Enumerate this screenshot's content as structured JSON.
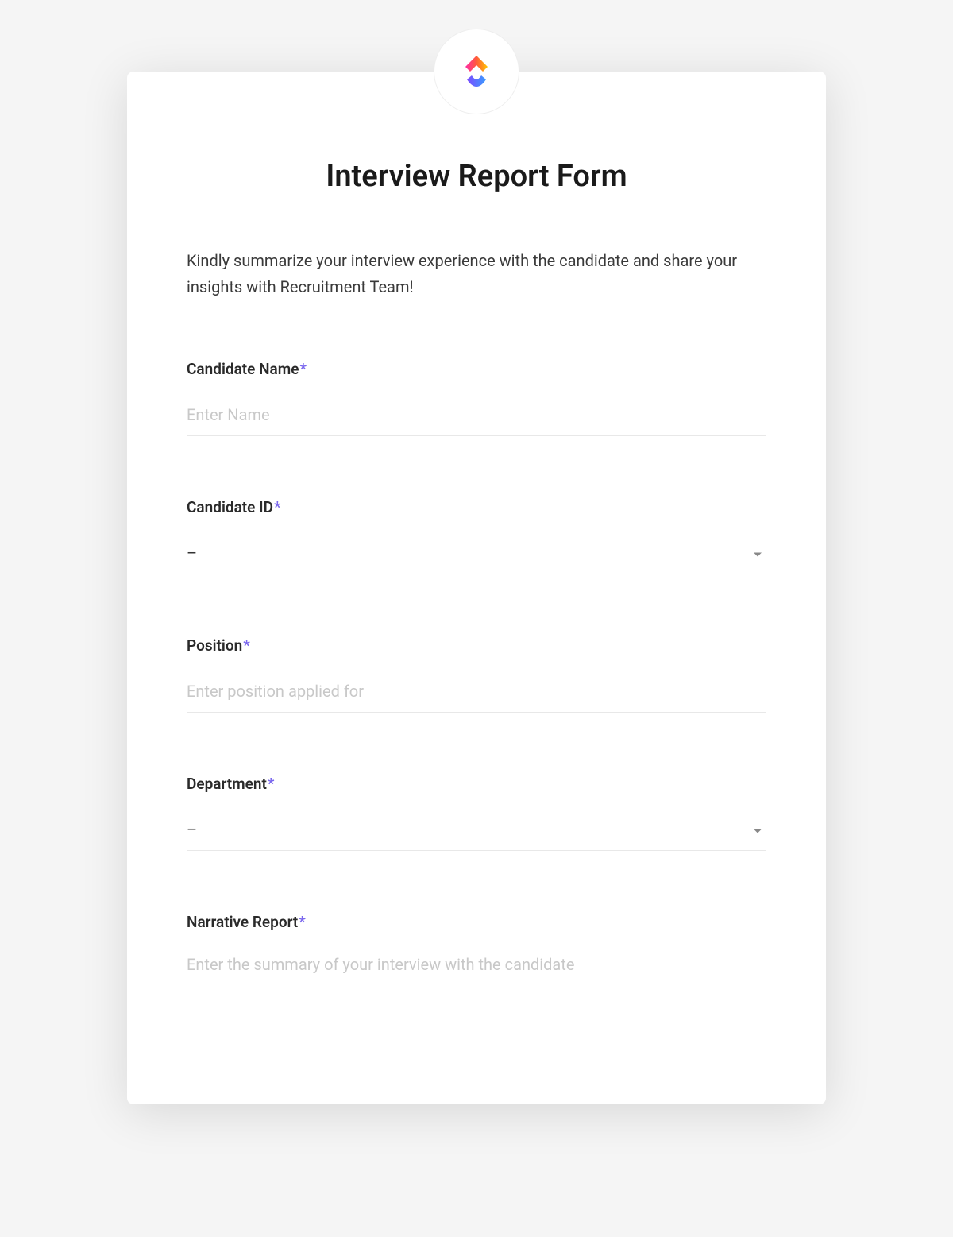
{
  "form": {
    "title": "Interview Report Form",
    "description": "Kindly summarize your interview experience with the candidate and share your insights with Recruitment Team!",
    "required_marker": "*",
    "fields": {
      "candidate_name": {
        "label": "Candidate Name",
        "placeholder": "Enter Name",
        "required": true
      },
      "candidate_id": {
        "label": "Candidate ID",
        "value": "–",
        "required": true
      },
      "position": {
        "label": "Position",
        "placeholder": "Enter position applied for",
        "required": true
      },
      "department": {
        "label": "Department",
        "value": "–",
        "required": true
      },
      "narrative_report": {
        "label": "Narrative Report",
        "placeholder": "Enter the summary of your interview with the candidate",
        "required": true
      }
    }
  },
  "logo": {
    "name": "clickup-logo"
  }
}
